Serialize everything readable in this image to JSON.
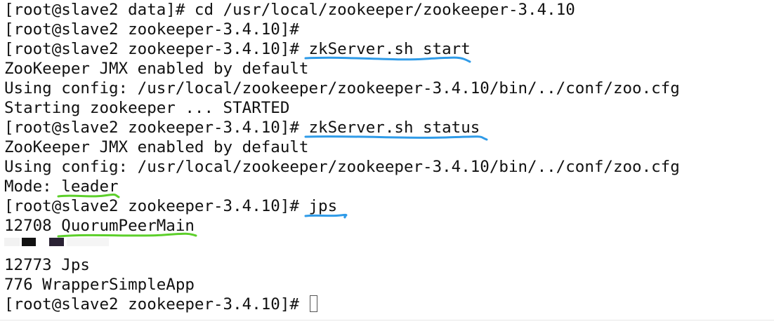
{
  "terminal": {
    "lines": [
      {
        "prompt": "[root@slave2 data]#",
        "command": " cd /usr/local/zookeeper/zookeeper-3.4.10"
      },
      {
        "prompt": "[root@slave2 zookeeper-3.4.10]#",
        "command": ""
      },
      {
        "prompt": "[root@slave2 zookeeper-3.4.10]#",
        "command": "zkServer.sh start"
      },
      {
        "text": "ZooKeeper JMX enabled by default"
      },
      {
        "text": "Using config: /usr/local/zookeeper/zookeeper-3.4.10/bin/../conf/zoo.cfg"
      },
      {
        "text": "Starting zookeeper ... STARTED"
      },
      {
        "prompt": "[root@slave2 zookeeper-3.4.10]#",
        "command": "zkServer.sh status"
      },
      {
        "text": "ZooKeeper JMX enabled by default"
      },
      {
        "text": "Using config: /usr/local/zookeeper/zookeeper-3.4.10/bin/../conf/zoo.cfg"
      },
      {
        "prefix": "Mode: ",
        "value": "leader"
      },
      {
        "prompt": "[root@slave2 zookeeper-3.4.10]#",
        "command": "jps"
      },
      {
        "prefix": "12708 ",
        "value": "QuorumPeerMain"
      },
      {
        "text": "12773 Jps"
      },
      {
        "text": "776 WrapperSimpleApp"
      },
      {
        "prompt": "[root@slave2 zookeeper-3.4.10]#",
        "command": ""
      }
    ]
  },
  "colors": {
    "background": "#ffffff",
    "text": "#111111",
    "annotation_blue": "#2f9be8",
    "annotation_green": "#5ccf2a",
    "cursor_border": "#555555"
  },
  "icons": {
    "cursor": "text-cursor-icon"
  }
}
